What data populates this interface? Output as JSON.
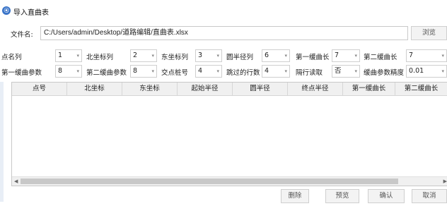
{
  "window": {
    "title": "导入直曲表",
    "title_icon": "app-logo-icon"
  },
  "file": {
    "label": "文件名:",
    "path": "C:/Users/admin/Desktop/道路编辑/直曲表.xlsx",
    "browse_label": "浏览"
  },
  "row1": [
    {
      "label": "点名列",
      "value": "1"
    },
    {
      "label": "北坐标列",
      "value": "2"
    },
    {
      "label": "东坐标列",
      "value": "3"
    },
    {
      "label": "圆半径列",
      "value": "6"
    },
    {
      "label": "第一缓曲长",
      "value": "7"
    },
    {
      "label": "第二缓曲长",
      "value": "7"
    }
  ],
  "row2": [
    {
      "label": "第一缓曲参数",
      "value": "8"
    },
    {
      "label": "第二缓曲参数",
      "value": "8"
    },
    {
      "label": "交点桩号",
      "value": "4"
    },
    {
      "label": "跳过的行数",
      "value": "4"
    },
    {
      "label": "隔行读取",
      "value": "否"
    },
    {
      "label": "缓曲参数精度",
      "value": "0.01"
    }
  ],
  "table": {
    "columns": [
      "点号",
      "北坐标",
      "东坐标",
      "起始半径",
      "圆半径",
      "终点半径",
      "第一缓曲长",
      "第二缓曲长"
    ],
    "rows": []
  },
  "footer": {
    "delete_label": "删除",
    "preview_label": "预览",
    "confirm_label": "确认",
    "cancel_label": "取消"
  }
}
